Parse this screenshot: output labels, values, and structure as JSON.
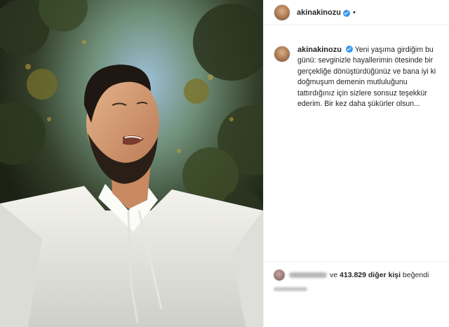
{
  "post": {
    "account": {
      "username": "akinakinozu",
      "verified_icon": "verified-badge-icon",
      "separator": "•"
    },
    "caption": {
      "username": "akinakinozu",
      "text": "Yeni yaşıma girdiğim bu günü: sevginizle hayallerimin ötesinde bir gerçekliğe dönüştürdüğünüz ve bana iyi ki doğmuşum demenin mutluluğunu tattırdığınız için sizlere sonsuz teşekkür ederim. Bir kez daha şükürler olsun..."
    },
    "likes": {
      "prefix": "ve",
      "count_text": "413.829 diğer kişi",
      "suffix": "beğendi"
    },
    "colors": {
      "verified": "#3897f0",
      "text": "#262626",
      "divider": "#efefef"
    }
  }
}
